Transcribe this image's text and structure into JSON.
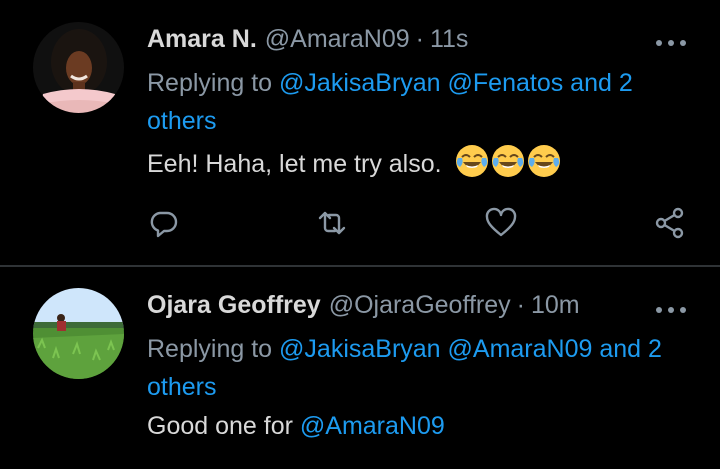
{
  "tweets": [
    {
      "name": "Amara N.",
      "handle": "@AmaraN09",
      "separator": "·",
      "time": "11s",
      "reply_prefix": "Replying to",
      "reply_mentions": "@JakisaBryan @Fenatos and 2 others",
      "text": "Eeh! Haha, let me try also.",
      "emoji": "face-with-tears-of-joy x3"
    },
    {
      "name": "Ojara Geoffrey",
      "handle": "@OjaraGeoffrey",
      "separator": "·",
      "time": "10m",
      "reply_prefix": "Replying to",
      "reply_mentions": "@JakisaBryan @AmaraN09 and 2 others",
      "text_prefix": "Good one for",
      "text_mention": "@AmaraN09"
    }
  ],
  "actions": [
    "reply-icon",
    "retweet-icon",
    "like-icon",
    "share-icon"
  ],
  "colors": {
    "background": "#000000",
    "text": "#d9d9d9",
    "secondary": "#8b98a5",
    "accent": "#1d9bf0",
    "divider": "#2f3336"
  }
}
